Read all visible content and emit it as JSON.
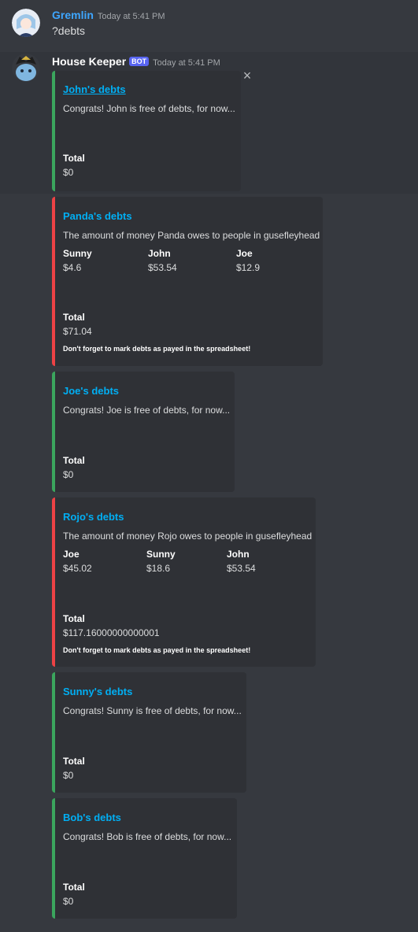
{
  "messages": [
    {
      "author": "Gremlin",
      "timestamp": "Today at 5:41 PM",
      "text": "?debts",
      "author_color": "#3ea6ff"
    },
    {
      "author": "House Keeper",
      "bot_tag": "BOT",
      "timestamp": "Today at 5:41 PM",
      "author_color": "#ffffff"
    }
  ],
  "close_icon": "×",
  "embeds": [
    {
      "title": "John's debts",
      "description": "Congrats! John is free of debts, for now...",
      "color": "green",
      "total_label": "Total",
      "total_value": "$0"
    },
    {
      "title": "Panda's debts",
      "description": "The amount of money Panda owes to people in gusefleyhead",
      "color": "red",
      "fields": [
        {
          "name": "Sunny",
          "value": "$4.6"
        },
        {
          "name": "John",
          "value": "$53.54"
        },
        {
          "name": "Joe",
          "value": "$12.9"
        }
      ],
      "total_label": "Total",
      "total_value": "$71.04",
      "footer": "Don't forget to mark debts as payed in the spreadsheet!"
    },
    {
      "title": "Joe's debts",
      "description": "Congrats! Joe is free of debts, for now...",
      "color": "green",
      "total_label": "Total",
      "total_value": "$0"
    },
    {
      "title": "Rojo's debts",
      "description": "The amount of money Rojo owes to people in gusefleyhead",
      "color": "red",
      "fields": [
        {
          "name": "Joe",
          "value": "$45.02"
        },
        {
          "name": "Sunny",
          "value": "$18.6"
        },
        {
          "name": "John",
          "value": "$53.54"
        }
      ],
      "total_label": "Total",
      "total_value": "$117.16000000000001",
      "footer": "Don't forget to mark debts as payed in the spreadsheet!"
    },
    {
      "title": "Sunny's debts",
      "description": "Congrats! Sunny is free of debts, for now...",
      "color": "green",
      "total_label": "Total",
      "total_value": "$0"
    },
    {
      "title": "Bob's debts",
      "description": "Congrats! Bob is free of debts, for now...",
      "color": "green",
      "total_label": "Total",
      "total_value": "$0"
    }
  ],
  "colors": {
    "background": "#36393f",
    "embed_background": "#2f3136",
    "link": "#00aff4",
    "green": "#3ba55d",
    "red": "#ed4245",
    "bot_tag": "#5865f2"
  }
}
